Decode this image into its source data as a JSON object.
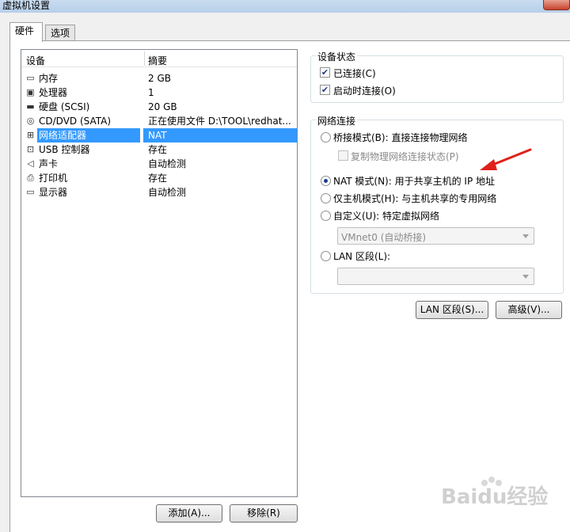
{
  "window": {
    "title": "虚拟机设置"
  },
  "tabs": [
    {
      "label": "硬件"
    },
    {
      "label": "选项"
    }
  ],
  "device_list": {
    "headers": [
      "设备",
      "摘要"
    ],
    "rows": [
      {
        "name": "内存",
        "summary": "2 GB",
        "icon": "memory-icon",
        "glyph": "▭"
      },
      {
        "name": "处理器",
        "summary": "1",
        "icon": "processor-icon",
        "glyph": "▣"
      },
      {
        "name": "硬盘 (SCSI)",
        "summary": "20 GB",
        "icon": "harddisk-icon",
        "glyph": "▬"
      },
      {
        "name": "CD/DVD (SATA)",
        "summary": "正在使用文件 D:\\TOOL\\redhat...",
        "icon": "cd-icon",
        "glyph": "◎"
      },
      {
        "name": "网络适配器",
        "summary": "NAT",
        "icon": "network-adapter-icon",
        "glyph": "⊞"
      },
      {
        "name": "USB 控制器",
        "summary": "存在",
        "icon": "usb-icon",
        "glyph": "⊡"
      },
      {
        "name": "声卡",
        "summary": "自动检测",
        "icon": "sound-icon",
        "glyph": "◁"
      },
      {
        "name": "打印机",
        "summary": "存在",
        "icon": "printer-icon",
        "glyph": "⎙"
      },
      {
        "name": "显示器",
        "summary": "自动检测",
        "icon": "display-icon",
        "glyph": "▭"
      }
    ],
    "selected_index": 4
  },
  "list_buttons": {
    "add": "添加(A)...",
    "remove": "移除(R)"
  },
  "device_status": {
    "title": "设备状态",
    "connected": {
      "label": "已连接(C)",
      "checked": true
    },
    "connect_at_power_on": {
      "label": "启动时连接(O)",
      "checked": true
    }
  },
  "network": {
    "title": "网络连接",
    "bridged": {
      "label": "桥接模式(B): 直接连接物理网络"
    },
    "replicate": {
      "label": "复制物理网络连接状态(P)"
    },
    "nat": {
      "label": "NAT 模式(N): 用于共享主机的 IP 地址",
      "selected": true
    },
    "host_only": {
      "label": "仅主机模式(H): 与主机共享的专用网络"
    },
    "custom": {
      "label": "自定义(U): 特定虚拟网络"
    },
    "custom_select": {
      "value": "VMnet0 (自动桥接)"
    },
    "lan_segment": {
      "label": "LAN 区段(L):"
    },
    "lan_select": {
      "value": ""
    }
  },
  "bottom_buttons": {
    "lan_segments": "LAN 区段(S)...",
    "advanced": "高级(V)..."
  },
  "colors": {
    "selection": "#3399ff",
    "annotation_arrow": "#e0201a"
  },
  "watermark": {
    "text": "Baidu经验"
  }
}
